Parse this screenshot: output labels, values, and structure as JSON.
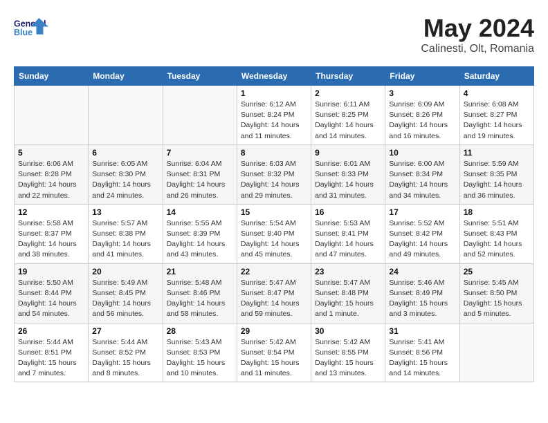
{
  "header": {
    "logo_line1": "General",
    "logo_line2": "Blue",
    "month": "May 2024",
    "location": "Calinesti, Olt, Romania"
  },
  "days_of_week": [
    "Sunday",
    "Monday",
    "Tuesday",
    "Wednesday",
    "Thursday",
    "Friday",
    "Saturday"
  ],
  "weeks": [
    [
      {
        "day": "",
        "info": ""
      },
      {
        "day": "",
        "info": ""
      },
      {
        "day": "",
        "info": ""
      },
      {
        "day": "1",
        "info": "Sunrise: 6:12 AM\nSunset: 8:24 PM\nDaylight: 14 hours\nand 11 minutes."
      },
      {
        "day": "2",
        "info": "Sunrise: 6:11 AM\nSunset: 8:25 PM\nDaylight: 14 hours\nand 14 minutes."
      },
      {
        "day": "3",
        "info": "Sunrise: 6:09 AM\nSunset: 8:26 PM\nDaylight: 14 hours\nand 16 minutes."
      },
      {
        "day": "4",
        "info": "Sunrise: 6:08 AM\nSunset: 8:27 PM\nDaylight: 14 hours\nand 19 minutes."
      }
    ],
    [
      {
        "day": "5",
        "info": "Sunrise: 6:06 AM\nSunset: 8:28 PM\nDaylight: 14 hours\nand 22 minutes."
      },
      {
        "day": "6",
        "info": "Sunrise: 6:05 AM\nSunset: 8:30 PM\nDaylight: 14 hours\nand 24 minutes."
      },
      {
        "day": "7",
        "info": "Sunrise: 6:04 AM\nSunset: 8:31 PM\nDaylight: 14 hours\nand 26 minutes."
      },
      {
        "day": "8",
        "info": "Sunrise: 6:03 AM\nSunset: 8:32 PM\nDaylight: 14 hours\nand 29 minutes."
      },
      {
        "day": "9",
        "info": "Sunrise: 6:01 AM\nSunset: 8:33 PM\nDaylight: 14 hours\nand 31 minutes."
      },
      {
        "day": "10",
        "info": "Sunrise: 6:00 AM\nSunset: 8:34 PM\nDaylight: 14 hours\nand 34 minutes."
      },
      {
        "day": "11",
        "info": "Sunrise: 5:59 AM\nSunset: 8:35 PM\nDaylight: 14 hours\nand 36 minutes."
      }
    ],
    [
      {
        "day": "12",
        "info": "Sunrise: 5:58 AM\nSunset: 8:37 PM\nDaylight: 14 hours\nand 38 minutes."
      },
      {
        "day": "13",
        "info": "Sunrise: 5:57 AM\nSunset: 8:38 PM\nDaylight: 14 hours\nand 41 minutes."
      },
      {
        "day": "14",
        "info": "Sunrise: 5:55 AM\nSunset: 8:39 PM\nDaylight: 14 hours\nand 43 minutes."
      },
      {
        "day": "15",
        "info": "Sunrise: 5:54 AM\nSunset: 8:40 PM\nDaylight: 14 hours\nand 45 minutes."
      },
      {
        "day": "16",
        "info": "Sunrise: 5:53 AM\nSunset: 8:41 PM\nDaylight: 14 hours\nand 47 minutes."
      },
      {
        "day": "17",
        "info": "Sunrise: 5:52 AM\nSunset: 8:42 PM\nDaylight: 14 hours\nand 49 minutes."
      },
      {
        "day": "18",
        "info": "Sunrise: 5:51 AM\nSunset: 8:43 PM\nDaylight: 14 hours\nand 52 minutes."
      }
    ],
    [
      {
        "day": "19",
        "info": "Sunrise: 5:50 AM\nSunset: 8:44 PM\nDaylight: 14 hours\nand 54 minutes."
      },
      {
        "day": "20",
        "info": "Sunrise: 5:49 AM\nSunset: 8:45 PM\nDaylight: 14 hours\nand 56 minutes."
      },
      {
        "day": "21",
        "info": "Sunrise: 5:48 AM\nSunset: 8:46 PM\nDaylight: 14 hours\nand 58 minutes."
      },
      {
        "day": "22",
        "info": "Sunrise: 5:47 AM\nSunset: 8:47 PM\nDaylight: 14 hours\nand 59 minutes."
      },
      {
        "day": "23",
        "info": "Sunrise: 5:47 AM\nSunset: 8:48 PM\nDaylight: 15 hours\nand 1 minute."
      },
      {
        "day": "24",
        "info": "Sunrise: 5:46 AM\nSunset: 8:49 PM\nDaylight: 15 hours\nand 3 minutes."
      },
      {
        "day": "25",
        "info": "Sunrise: 5:45 AM\nSunset: 8:50 PM\nDaylight: 15 hours\nand 5 minutes."
      }
    ],
    [
      {
        "day": "26",
        "info": "Sunrise: 5:44 AM\nSunset: 8:51 PM\nDaylight: 15 hours\nand 7 minutes."
      },
      {
        "day": "27",
        "info": "Sunrise: 5:44 AM\nSunset: 8:52 PM\nDaylight: 15 hours\nand 8 minutes."
      },
      {
        "day": "28",
        "info": "Sunrise: 5:43 AM\nSunset: 8:53 PM\nDaylight: 15 hours\nand 10 minutes."
      },
      {
        "day": "29",
        "info": "Sunrise: 5:42 AM\nSunset: 8:54 PM\nDaylight: 15 hours\nand 11 minutes."
      },
      {
        "day": "30",
        "info": "Sunrise: 5:42 AM\nSunset: 8:55 PM\nDaylight: 15 hours\nand 13 minutes."
      },
      {
        "day": "31",
        "info": "Sunrise: 5:41 AM\nSunset: 8:56 PM\nDaylight: 15 hours\nand 14 minutes."
      },
      {
        "day": "",
        "info": ""
      }
    ]
  ]
}
